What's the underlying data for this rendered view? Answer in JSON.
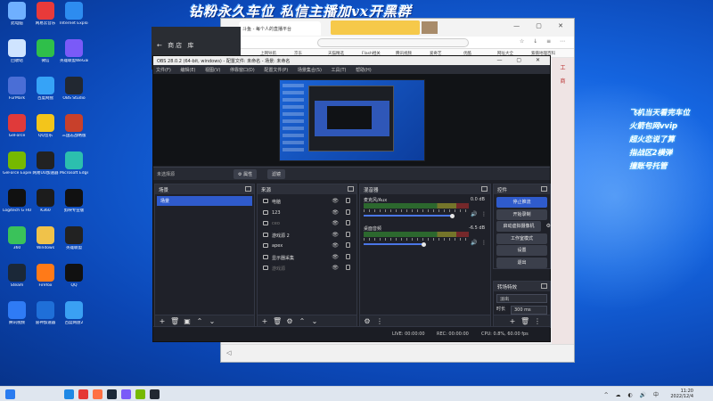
{
  "banner": "钻粉永久车位 私信主播加vx开黑群",
  "side_notes": [
    "飞机当天看完车位",
    "火箭包网vvip",
    "超火恋说了算",
    "指战区2横弹",
    "撞账号托管"
  ],
  "desktop_icons": [
    {
      "label": "此电脑",
      "color": "#6fb0ff"
    },
    {
      "label": "网易云音乐",
      "color": "#e83a3a"
    },
    {
      "label": "Internet Explorer",
      "color": "#2d8cf0"
    },
    {
      "label": "回收站",
      "color": "#cfe4ff"
    },
    {
      "label": "微信",
      "color": "#2fbf4a"
    },
    {
      "label": "英雄联盟WeGame",
      "color": "#7a5af8"
    },
    {
      "label": "FurMark",
      "color": "#4a6ed6"
    },
    {
      "label": "百度网盘",
      "color": "#36a3f7"
    },
    {
      "label": "OBS Studio",
      "color": "#222831"
    },
    {
      "label": "GeForce",
      "color": "#e03a3a"
    },
    {
      "label": "QQ音乐",
      "color": "#f3c51b"
    },
    {
      "label": "三国志战略版",
      "color": "#c8402b"
    },
    {
      "label": "GeForce Experience",
      "color": "#76b900"
    },
    {
      "label": "网易UU加速器",
      "color": "#222"
    },
    {
      "label": "Microsoft Edge",
      "color": "#2cbfae"
    },
    {
      "label": "Logitech G HUB",
      "color": "#111"
    },
    {
      "label": "K360",
      "color": "#1c1c1c"
    },
    {
      "label": "剪映专业版",
      "color": "#111"
    },
    {
      "label": "360",
      "color": "#3ac25a"
    },
    {
      "label": "Windows",
      "color": "#f0c24a"
    },
    {
      "label": "英雄联盟",
      "color": "#222"
    },
    {
      "label": "Steam",
      "color": "#1b2838"
    },
    {
      "label": "Firefox",
      "color": "#ff7a18"
    },
    {
      "label": "QQ",
      "color": "#111"
    },
    {
      "label": "腾讯视频",
      "color": "#2f7bf5"
    },
    {
      "label": "雷神加速器",
      "color": "#1f6fd8"
    },
    {
      "label": "百度网盘2",
      "color": "#3aa0f3"
    }
  ],
  "store_window": {
    "nav": "← 商店 库"
  },
  "browser": {
    "tab_title": "斗鱼 - 每个人的直播平台",
    "bookmarks": [
      "百度",
      "上网导航",
      "京东",
      "天猫精选",
      "Flash相关",
      "腾讯视频",
      "爱奇艺",
      "优酷",
      "网址大全",
      "紫薇地理百科"
    ],
    "side_tabs": [
      "工",
      "商"
    ],
    "bottom_back": "◁"
  },
  "obs": {
    "title": "OBS 28.0.2 (64-bit, windows) - 配置文件: 未命名 - 场景: 未命名",
    "menu": [
      "文件(F)",
      "编辑(E)",
      "视图(V)",
      "停靠窗口(D)",
      "配置文件(P)",
      "场景集合(S)",
      "工具(T)",
      "帮助(H)"
    ],
    "no_source": "未选择源",
    "props_btn": "⚙ 属性",
    "filters_btn": "滤镜",
    "docks": {
      "scenes": {
        "title": "场景",
        "items": [
          "场景"
        ]
      },
      "sources": {
        "title": "来源",
        "items": [
          {
            "name": "电脑",
            "dim": false
          },
          {
            "name": "123",
            "dim": false
          },
          {
            "name": "ceo",
            "dim": true
          },
          {
            "name": "游戏源 2",
            "dim": false
          },
          {
            "name": "apex",
            "dim": false
          },
          {
            "name": "显示器采集",
            "dim": false
          },
          {
            "name": "游戏源",
            "dim": true
          }
        ]
      },
      "mixer": {
        "title": "混音器",
        "channels": [
          {
            "name": "麦克风/Aux",
            "db": "0.0 dB",
            "level": 0.92
          },
          {
            "name": "桌面音频",
            "db": "-6.5 dB",
            "level": 0.62
          }
        ]
      },
      "controls": {
        "title": "控件",
        "buttons": [
          "停止推流",
          "开始录制",
          "启动虚拟摄像机",
          "工作室模式",
          "设置",
          "退出"
        ]
      },
      "transitions": {
        "title": "转场特效",
        "type": "淡出",
        "duration_label": "时长",
        "duration": "300 ms"
      }
    },
    "status": {
      "live": "LIVE: 00:00:00",
      "rec": "REC: 00:00:00",
      "cpu": "CPU: 0.8%, 60.00 fps"
    }
  },
  "taskbar": {
    "time": "11:20",
    "date": "2022/12/4"
  }
}
